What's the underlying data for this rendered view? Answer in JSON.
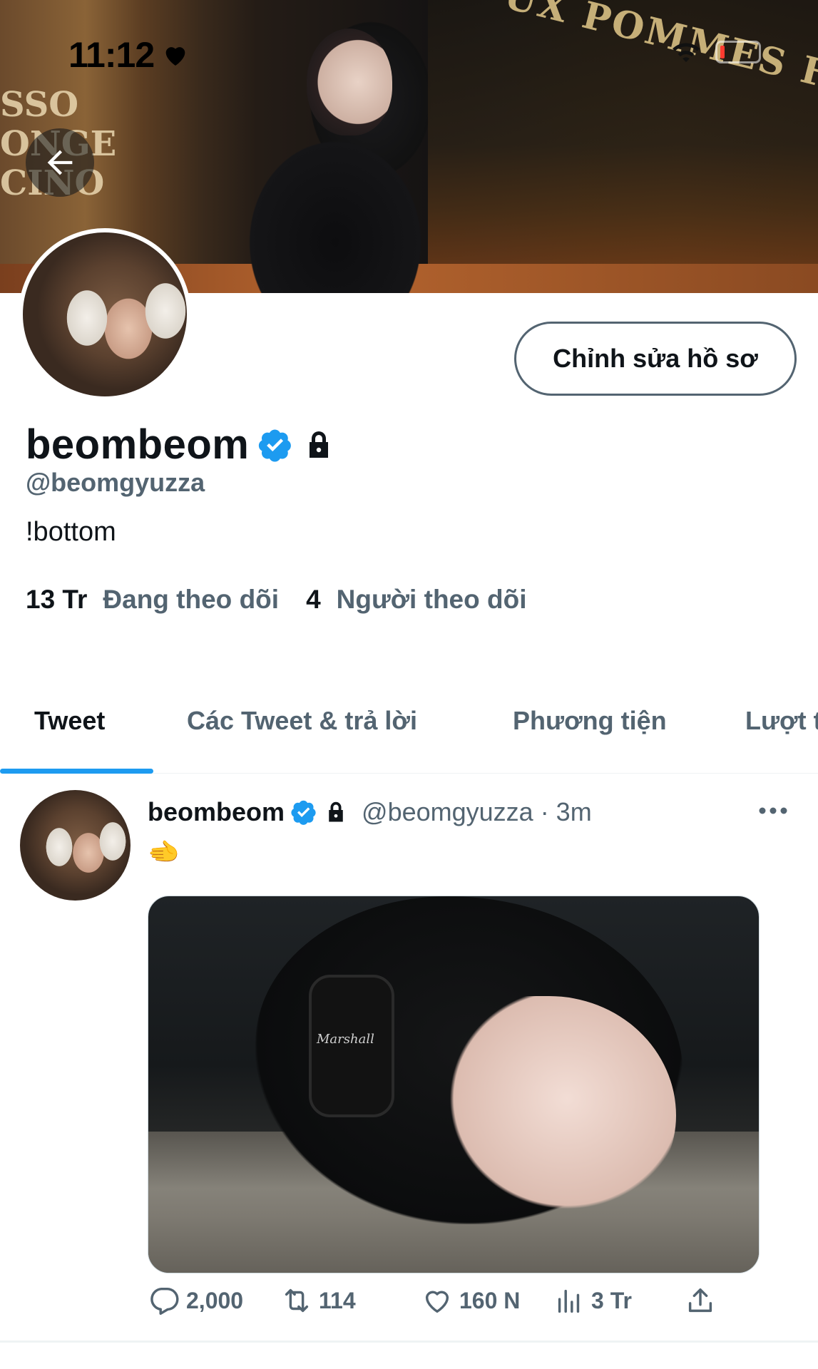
{
  "status_bar": {
    "time": "11:12"
  },
  "banner": {
    "sign_text": "UX POMMES FRA",
    "window_text": "SSO\nONGE\nCINO"
  },
  "profile": {
    "edit_button_label": "Chỉnh sửa hồ sơ",
    "display_name": "beombeom",
    "handle": "@beomgyuzza",
    "bio": "!bottom",
    "following_count": "13 Tr",
    "following_label": "Đang theo dõi",
    "followers_count": "4",
    "followers_label": "Người theo dõi"
  },
  "tabs": [
    {
      "label": "Tweet",
      "active": true
    },
    {
      "label": "Các Tweet & trả lời",
      "active": false
    },
    {
      "label": "Phương tiện",
      "active": false
    },
    {
      "label": "Lượt t",
      "active": false
    }
  ],
  "tweet": {
    "name": "beombeom",
    "handle_time": "@beomgyuzza · 3m",
    "text": "🫲",
    "media_brand": "Marshall",
    "replies": "2,000",
    "retweets": "114",
    "likes": "160 N",
    "views": "3 Tr"
  },
  "colors": {
    "accent": "#1d9bf0",
    "text": "#0f1419",
    "secondary": "#536471"
  },
  "icons": [
    "back-arrow-icon",
    "heart-icon",
    "wifi-icon",
    "battery-icon",
    "verified-icon",
    "lock-icon",
    "more-icon",
    "reply-icon",
    "retweet-icon",
    "like-icon",
    "views-icon",
    "share-icon"
  ]
}
